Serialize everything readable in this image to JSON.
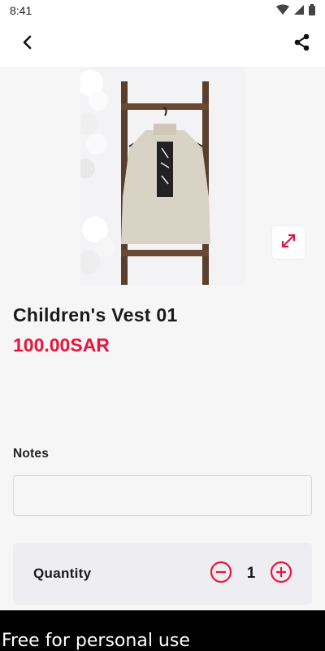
{
  "status_bar": {
    "time": "8:41",
    "icons": [
      "wifi-icon",
      "signal-icon",
      "battery-icon"
    ]
  },
  "app_bar": {
    "back_icon": "back-arrow-icon",
    "share_icon": "share-icon"
  },
  "product": {
    "title": "Children's Vest 01",
    "price": "100.00SAR",
    "image_alt": "Children's vest hanging on wooden ladder"
  },
  "notes": {
    "label": "Notes",
    "value": "",
    "placeholder": ""
  },
  "quantity": {
    "label": "Quantity",
    "value": "1"
  },
  "watermark": {
    "text": "Free for personal use"
  },
  "colors": {
    "accent": "#e8163d",
    "text": "#1a1a1a",
    "quantity_bg": "#eeeef2"
  }
}
